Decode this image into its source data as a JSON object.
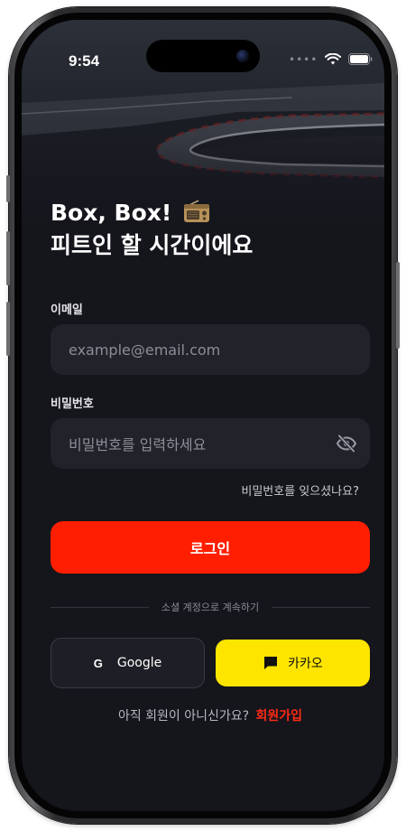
{
  "status_bar": {
    "time": "9:54",
    "signal_dots": "••••"
  },
  "headline": {
    "line1": "Box, Box!",
    "line2": "피트인 할 시간이에요"
  },
  "email": {
    "label": "이메일",
    "placeholder": "example@email.com"
  },
  "password": {
    "label": "비밀번호",
    "placeholder": "비밀번호를 입력하세요"
  },
  "forgot_password": "비밀번호를 잊으셨나요?",
  "login_button": "로그인",
  "divider_text": "소셜 계정으로 계속하기",
  "social": {
    "google": {
      "icon_letter": "G",
      "label": "Google"
    },
    "kakao": {
      "label": "카카오"
    }
  },
  "signup": {
    "prompt": "아직 회원이 아니신가요?",
    "link": "회원가입"
  },
  "colors": {
    "accent": "#ff1e00",
    "background": "#15151c",
    "field": "#22222b",
    "kakao": "#fee500"
  },
  "icons": {
    "title": "radio-icon",
    "password_toggle": "eye-off-icon",
    "kakao": "chat-bubble-icon",
    "wifi": "wifi-icon",
    "battery": "battery-icon"
  }
}
